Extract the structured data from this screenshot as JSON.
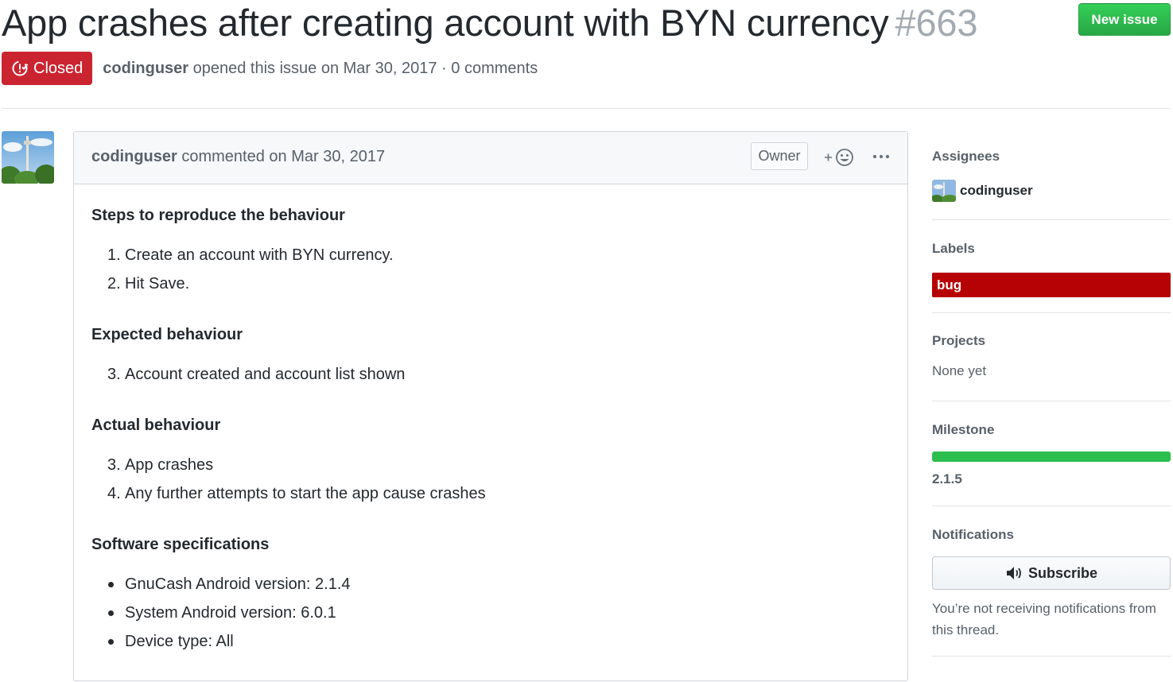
{
  "issue": {
    "title": "App crashes after creating account with BYN currency",
    "number": "#663",
    "state": "Closed",
    "author": "codinguser",
    "opened_text": "opened this issue on Mar 30, 2017 · 0 comments"
  },
  "header": {
    "new_issue_label": "New issue"
  },
  "comment": {
    "author": "codinguser",
    "commented_text": "commented on Mar 30, 2017",
    "role_badge": "Owner",
    "sections": {
      "steps": {
        "heading": "Steps to reproduce the behaviour",
        "items": [
          {
            "num": "1.",
            "text": "Create an account with BYN currency."
          },
          {
            "num": "2.",
            "text": "Hit Save."
          }
        ]
      },
      "expected": {
        "heading": "Expected behaviour",
        "items": [
          {
            "num": "3.",
            "text": "Account created and account list shown"
          }
        ]
      },
      "actual": {
        "heading": "Actual behaviour",
        "items": [
          {
            "num": "3.",
            "text": "App crashes"
          },
          {
            "num": "4.",
            "text": "Any further attempts to start the app cause crashes"
          }
        ]
      },
      "specs": {
        "heading": "Software specifications",
        "items": [
          {
            "text": "GnuCash Android version: 2.1.4"
          },
          {
            "text": "System Android version: 6.0.1"
          },
          {
            "text": "Device type: All"
          }
        ]
      }
    }
  },
  "sidebar": {
    "assignees": {
      "title": "Assignees",
      "name": "codinguser"
    },
    "labels": {
      "title": "Labels",
      "items": [
        {
          "name": "bug",
          "color": "#b60205"
        }
      ]
    },
    "projects": {
      "title": "Projects",
      "value": "None yet"
    },
    "milestone": {
      "title": "Milestone",
      "name": "2.1.5",
      "progress": 1.0,
      "color": "#2cbe4e"
    },
    "notifications": {
      "title": "Notifications",
      "subscribe_label": "Subscribe",
      "description": "You’re not receiving notifications from this thread."
    }
  },
  "colors": {
    "closed": "#cb2431",
    "new_issue": "#28a745",
    "label_bug": "#b60205",
    "milestone": "#2cbe4e"
  },
  "icons": {
    "state": "issue-closed-icon",
    "reaction": "smiley-icon",
    "more": "kebab-horizontal-icon",
    "subscribe": "unmute-icon"
  }
}
